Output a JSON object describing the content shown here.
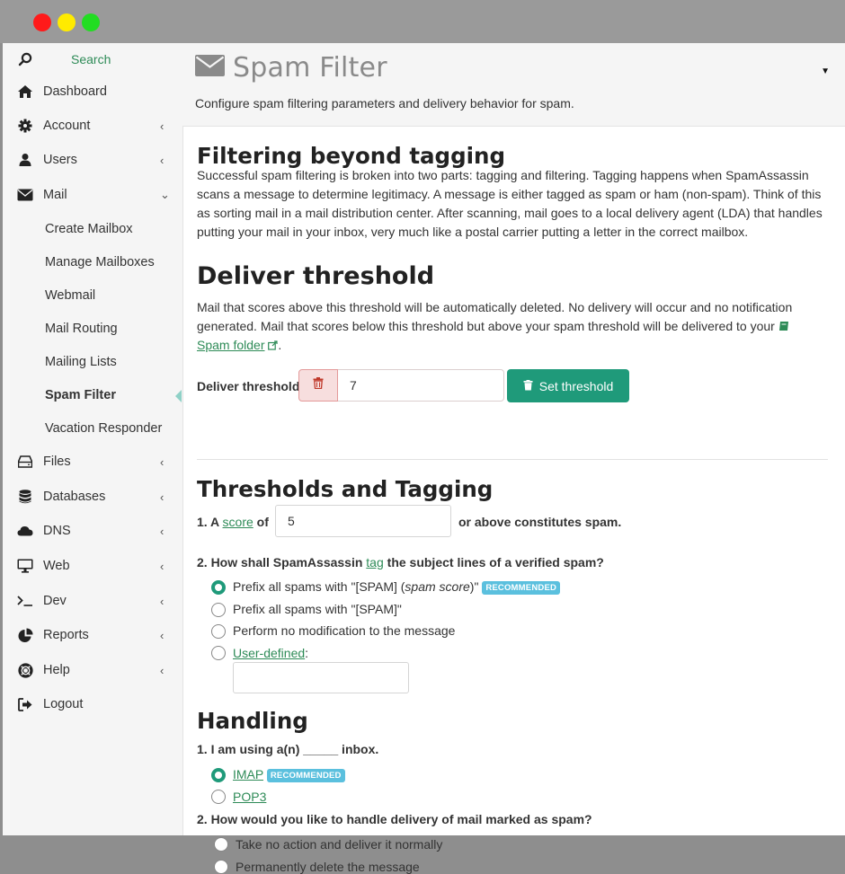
{
  "window": {
    "controls": [
      "close",
      "minimize",
      "maximize"
    ]
  },
  "sidebar": {
    "search_label": "Search",
    "items": [
      {
        "label": "Dashboard",
        "icon": "home-icon"
      },
      {
        "label": "Account",
        "icon": "gear-icon",
        "chevron": "<"
      },
      {
        "label": "Users",
        "icon": "user-icon",
        "chevron": "<"
      },
      {
        "label": "Mail",
        "icon": "envelope-icon",
        "chevron": "expanded"
      },
      {
        "label": "Create Mailbox"
      },
      {
        "label": "Manage Mailboxes"
      },
      {
        "label": "Webmail"
      },
      {
        "label": "Mail Routing"
      },
      {
        "label": "Mailing Lists"
      },
      {
        "label": "Spam Filter",
        "active": true
      },
      {
        "label": "Vacation Responder"
      },
      {
        "label": "Files",
        "icon": "drive-icon",
        "chevron": "<"
      },
      {
        "label": "Databases",
        "icon": "database-icon",
        "chevron": "<"
      },
      {
        "label": "DNS",
        "icon": "cloud-icon",
        "chevron": "<"
      },
      {
        "label": "Web",
        "icon": "monitor-icon",
        "chevron": "<"
      },
      {
        "label": "Dev",
        "icon": "terminal-icon",
        "chevron": "<"
      },
      {
        "label": "Reports",
        "icon": "pie-chart-icon",
        "chevron": "<"
      },
      {
        "label": "Help",
        "icon": "lifebuoy-icon",
        "chevron": "<"
      },
      {
        "label": "Logout",
        "icon": "sign-out-icon"
      }
    ]
  },
  "header": {
    "title": "Spam Filter",
    "subtitle": "Configure spam filtering parameters and delivery behavior for spam."
  },
  "filtering": {
    "heading": "Filtering beyond tagging",
    "body": "Successful spam filtering is broken into two parts: tagging and filtering. Tagging happens when SpamAssassin scans a message to determine legitimacy. A message is either tagged as spam or ham (non-spam). Think of this as sorting mail in a mail distribution center. After scanning, mail goes to a local delivery agent (LDA) that handles putting your mail in your inbox, very much like a postal carrier putting a letter in the correct mailbox."
  },
  "deliver": {
    "heading": "Deliver threshold",
    "body": "Mail that scores above this threshold will be automatically deleted. No delivery will occur and no notification generated. Mail that scores below this threshold but above your spam threshold will be delivered to your",
    "folder_link": "Spam folder",
    "label": "Deliver threshold",
    "value": "7",
    "button": "Set threshold"
  },
  "tagging": {
    "heading": "Thresholds and Tagging",
    "q1_prefix": "1. A",
    "q1_link": "score",
    "q1_of": "of",
    "q1_value": "5",
    "q1_suffix": "or above constitutes spam.",
    "q2_prefix": "2. How shall SpamAssassin",
    "q2_link": "tag",
    "q2_suffix": "the subject lines of a verified spam?",
    "options": [
      {
        "text_a": "Prefix all spams with \"[SPAM] (",
        "text_em": "spam score",
        "text_b": ")\"",
        "badge": "RECOMMENDED",
        "selected": true
      },
      {
        "text": "Prefix all spams with \"[SPAM]\"",
        "selected": false
      },
      {
        "text": "Perform no modification to the message",
        "selected": false
      },
      {
        "link": "User-defined",
        "suffix": ":",
        "selected": false
      }
    ],
    "user_defined_value": ""
  },
  "handling": {
    "heading": "Handling",
    "q1": "1. I am using a(n) _____ inbox.",
    "inbox_options": [
      {
        "link": "IMAP",
        "badge": "RECOMMENDED",
        "selected": true
      },
      {
        "link": "POP3",
        "selected": false
      }
    ],
    "q2": "2. How would you like to handle delivery of mail marked as spam?",
    "delivery_options": [
      {
        "text": "Take no action and deliver it normally",
        "selected": false
      },
      {
        "text": "Permanently delete the message",
        "selected": false
      }
    ]
  },
  "colors": {
    "accent": "#1f9a7a",
    "link": "#2e8b57",
    "badge": "#5bc0de",
    "danger_bg": "#f7dede"
  }
}
